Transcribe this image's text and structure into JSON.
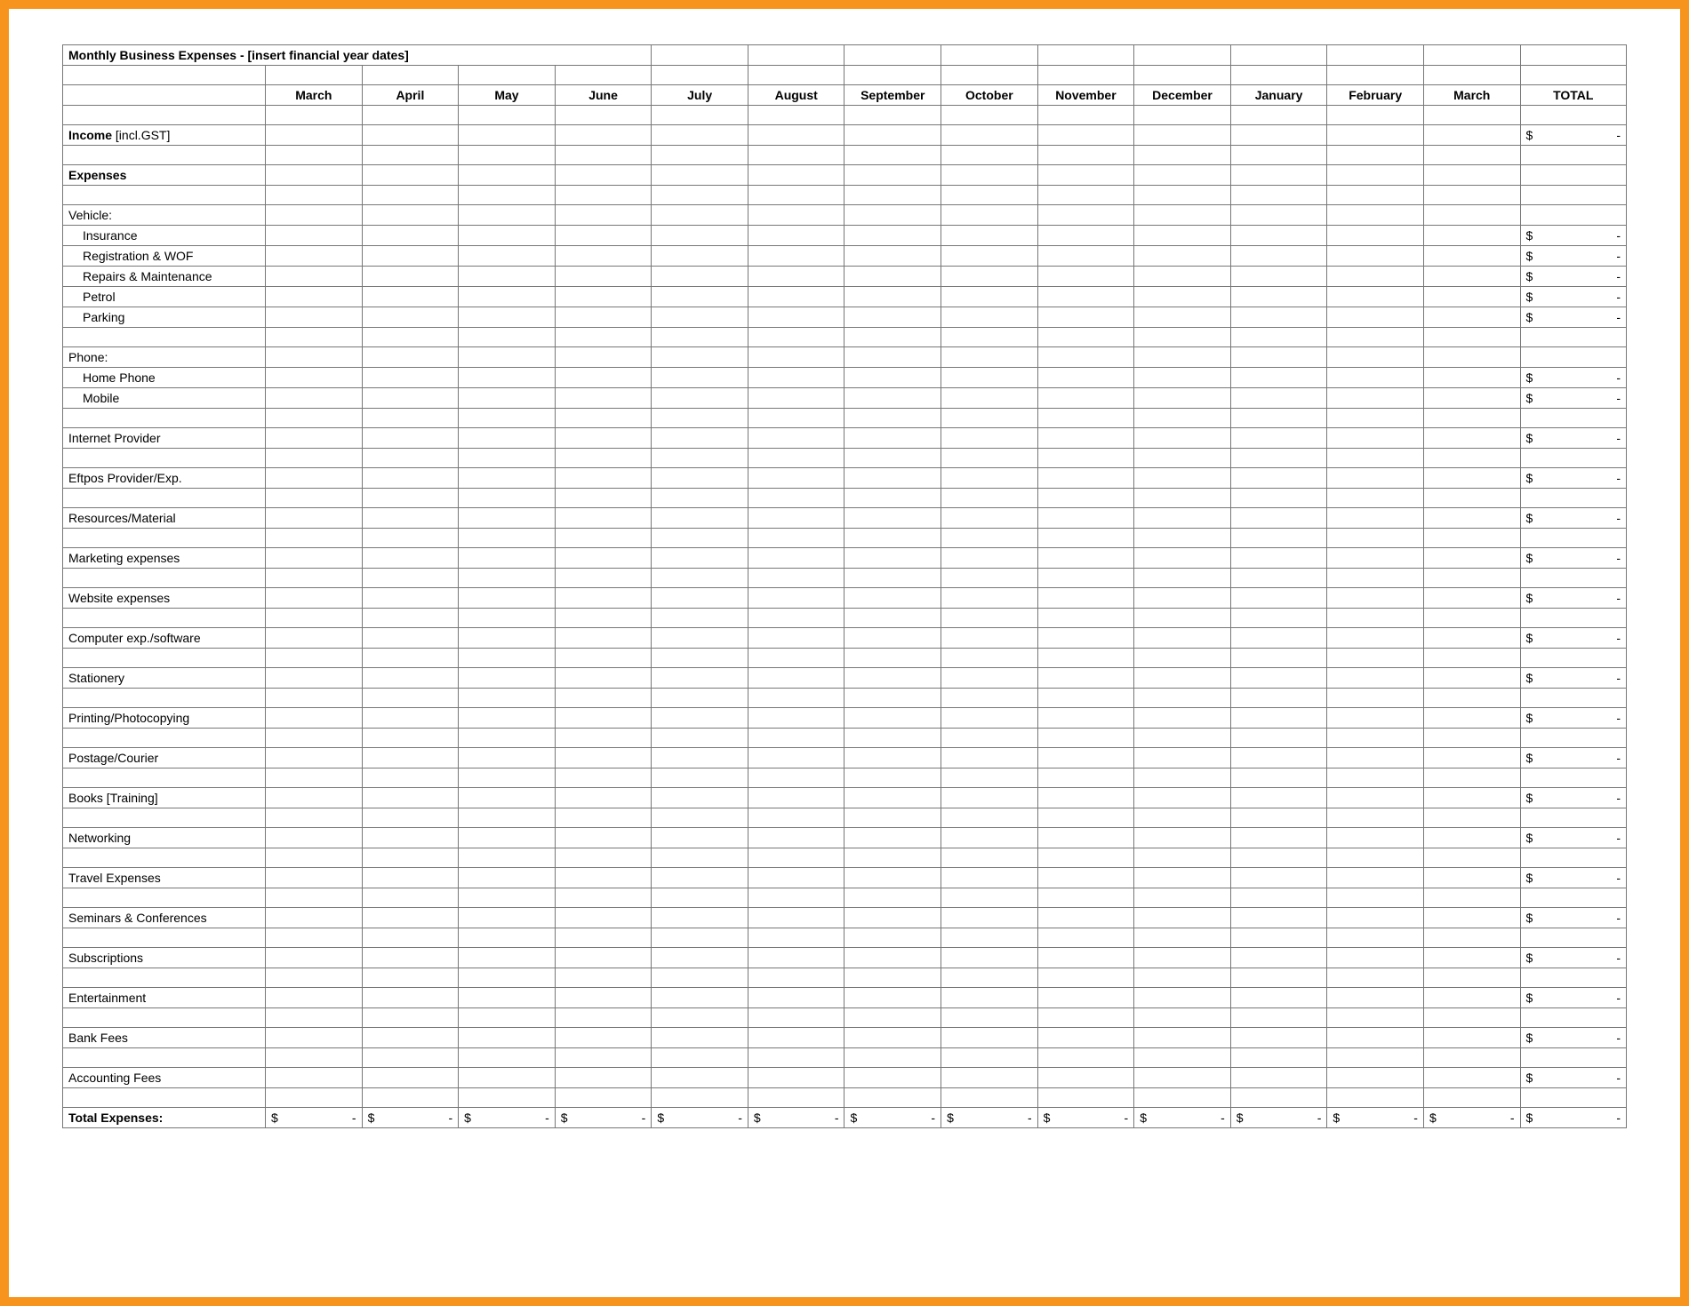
{
  "title": "Monthly Business Expenses - [insert financial year dates]",
  "months": [
    "March",
    "April",
    "May",
    "June",
    "July",
    "August",
    "September",
    "October",
    "November",
    "December",
    "January",
    "February",
    "March"
  ],
  "total_header": "TOTAL",
  "currency_symbol": "$",
  "empty_value": "-",
  "income": {
    "label_bold": "Income",
    "label_rest": " [incl.GST]"
  },
  "expenses_header": "Expenses",
  "groups": [
    {
      "heading": "Vehicle:",
      "items": [
        {
          "label": "Insurance"
        },
        {
          "label": "Registration & WOF"
        },
        {
          "label": "Repairs & Maintenance"
        },
        {
          "label": "Petrol"
        },
        {
          "label": "Parking"
        }
      ]
    },
    {
      "heading": "Phone:",
      "items": [
        {
          "label": "Home Phone"
        },
        {
          "label": "Mobile"
        }
      ]
    }
  ],
  "flat_items": [
    {
      "label": "Internet Provider"
    },
    {
      "label": "Eftpos Provider/Exp."
    },
    {
      "label": "Resources/Material"
    },
    {
      "label": "Marketing expenses"
    },
    {
      "label": "Website expenses"
    },
    {
      "label": "Computer exp./software"
    },
    {
      "label": "Stationery"
    },
    {
      "label": "Printing/Photocopying"
    },
    {
      "label": "Postage/Courier"
    },
    {
      "label": "Books [Training]"
    },
    {
      "label": "Networking"
    },
    {
      "label": "Travel Expenses"
    },
    {
      "label": "Seminars & Conferences"
    },
    {
      "label": "Subscriptions"
    },
    {
      "label": "Entertainment"
    },
    {
      "label": "Bank Fees"
    },
    {
      "label": "Accounting Fees"
    }
  ],
  "total_expenses_label": "Total Expenses:"
}
